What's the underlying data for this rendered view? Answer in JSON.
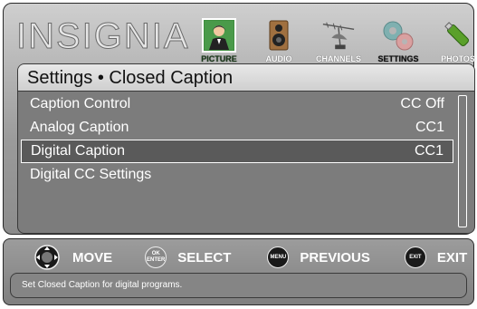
{
  "brand": {
    "logo_text": "INSIGNIA"
  },
  "menu_tabs": [
    {
      "label": "PICTURE",
      "icon": "picture-icon",
      "active": true
    },
    {
      "label": "AUDIO",
      "icon": "speaker-icon",
      "active": false
    },
    {
      "label": "CHANNELS",
      "icon": "antenna-icon",
      "active": false
    },
    {
      "label": "SETTINGS",
      "icon": "gears-icon",
      "active": false
    },
    {
      "label": "PHOTOS",
      "icon": "usb-drive-icon",
      "active": false
    }
  ],
  "panel": {
    "title": "Settings • Closed Caption",
    "items": [
      {
        "label": "Caption Control",
        "value": "CC Off"
      },
      {
        "label": "Analog Caption",
        "value": "CC1"
      },
      {
        "label": "Digital Caption",
        "value": "CC1",
        "selected": true
      },
      {
        "label": "Digital CC Settings",
        "value": ""
      }
    ]
  },
  "footer": {
    "hints": [
      {
        "icon": "dpad-icon",
        "label": "MOVE"
      },
      {
        "icon": "ok-enter-icon",
        "button_text": "OK ENTER",
        "label": "SELECT"
      },
      {
        "icon": "menu-button-icon",
        "button_text": "MENU",
        "label": "PREVIOUS"
      },
      {
        "icon": "exit-button-icon",
        "button_text": "EXIT",
        "label": "EXIT"
      }
    ],
    "help_text": "Set Closed Caption for digital programs."
  },
  "colors": {
    "active_tab": "#3f8f3f",
    "panel_bg": "#7c7c7c",
    "frame_bg": "#b5b5b5"
  }
}
